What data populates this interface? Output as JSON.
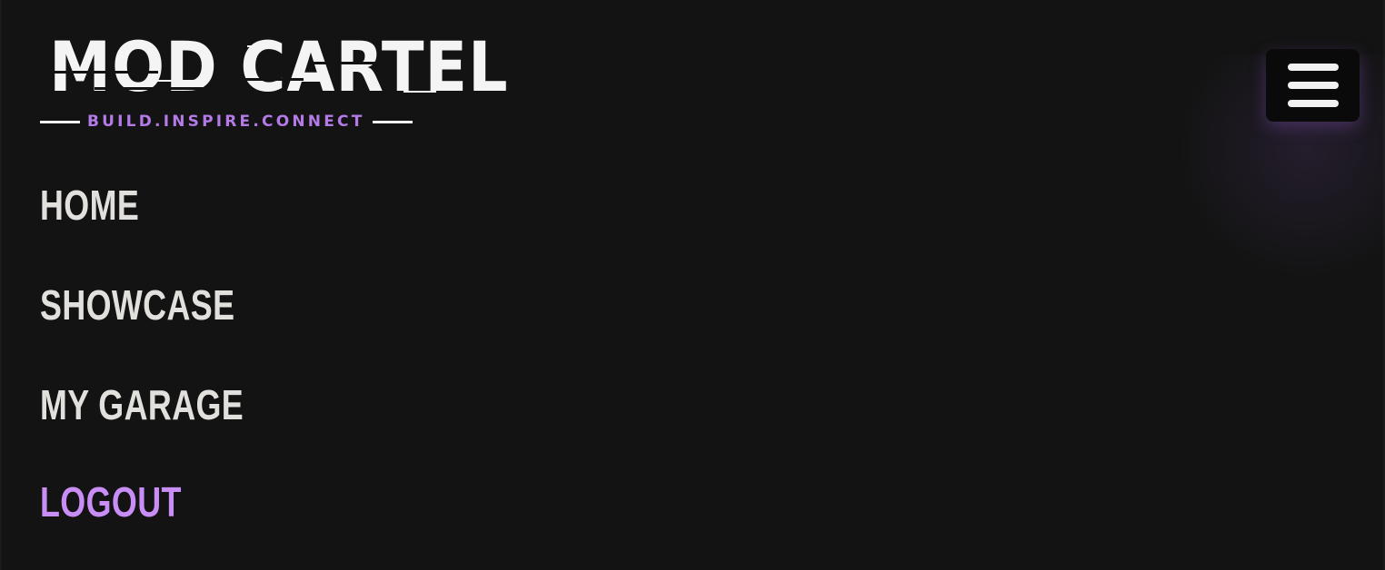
{
  "brand": {
    "title": "MOD CARTEL",
    "tagline": "BUILD.INSPIRE.CONNECT"
  },
  "menu_button": {
    "icon": "hamburger-menu-icon"
  },
  "nav": {
    "items": [
      {
        "label": "HOME"
      },
      {
        "label": "SHOWCASE"
      },
      {
        "label": "MY GARAGE"
      },
      {
        "label": "LOGOUT"
      }
    ]
  },
  "colors": {
    "background": "#131313",
    "text": "#e2e0dc",
    "accent": "#c98ef5",
    "tagline": "#b47ae8",
    "button_bg": "#0a0a0a"
  }
}
